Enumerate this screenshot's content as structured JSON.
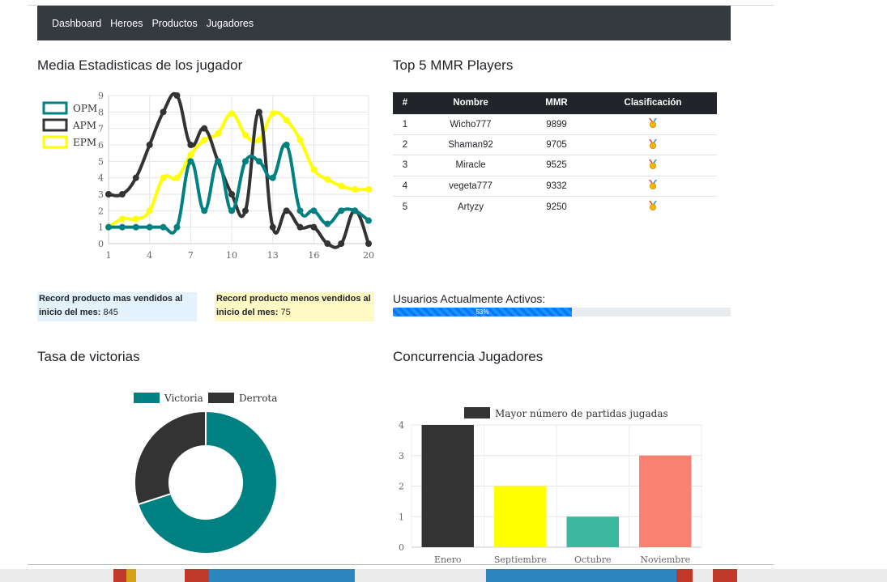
{
  "nav": {
    "items": [
      "Dashboard",
      "Heroes",
      "Productos",
      "Jugadores"
    ]
  },
  "sections": {
    "stats_title": "Media Estadisticas de los jugador",
    "mmr_title": "Top 5 MMR Players",
    "winrate_title": "Tasa de victorias",
    "concurrency_title": "Concurrencia Jugadores"
  },
  "mmr_table": {
    "headers": [
      "#",
      "Nombre",
      "MMR",
      "Clasificación"
    ],
    "rows": [
      {
        "rank": "1",
        "name": "Wicho777",
        "mmr": "9899",
        "icon": "medal-icon"
      },
      {
        "rank": "2",
        "name": "Shaman92",
        "mmr": "9705",
        "icon": "medal-icon"
      },
      {
        "rank": "3",
        "name": "Miracle",
        "mmr": "9525",
        "icon": "medal-icon"
      },
      {
        "rank": "4",
        "name": "vegeta777",
        "mmr": "9332",
        "icon": "medal-icon"
      },
      {
        "rank": "5",
        "name": "Artyzy",
        "mmr": "9250",
        "icon": "medal-icon"
      }
    ]
  },
  "records": {
    "most_label": "Record producto mas vendidos al inicio del mes:",
    "most_value": "845",
    "least_label": "Record producto menos vendidos al inicio del mes:",
    "least_value": "75"
  },
  "active_users": {
    "label": "Usuarios Actualmente Activos:",
    "percent_text": "53%",
    "percent": 53
  },
  "colors": {
    "teal": "#008080",
    "dark": "#333333",
    "yellow": "#ffff00",
    "green": "#3cb89e",
    "salmon": "#fa8072",
    "progress": "#007bff"
  },
  "chart_data": [
    {
      "type": "line",
      "x": [
        1,
        2,
        3,
        4,
        5,
        6,
        7,
        8,
        9,
        10,
        11,
        12,
        13,
        14,
        15,
        16,
        17,
        18,
        19,
        20
      ],
      "x_ticks": [
        1,
        4,
        7,
        10,
        13,
        16,
        20
      ],
      "ylim": [
        0,
        9
      ],
      "y_ticks": [
        0,
        1,
        2,
        3,
        4,
        5,
        6,
        7,
        8,
        9
      ],
      "legend": "top-left",
      "series": [
        {
          "name": "OPM",
          "color": "#008080",
          "values": [
            1,
            1,
            1,
            1,
            1,
            1,
            5,
            2,
            5,
            2,
            5,
            5,
            4,
            6,
            2,
            2,
            1.2,
            2,
            2,
            1.4
          ]
        },
        {
          "name": "APM",
          "color": "#333333",
          "values": [
            3,
            3,
            4,
            6,
            8,
            9,
            6,
            7,
            5,
            3,
            2,
            8,
            1,
            2,
            1,
            1,
            0,
            0,
            2,
            0
          ]
        },
        {
          "name": "EPM",
          "color": "#ffff00",
          "values": [
            1,
            1.5,
            1.5,
            2,
            4,
            4,
            5.4,
            6.3,
            6.7,
            7.9,
            6.6,
            6.3,
            7.9,
            7.5,
            6.3,
            4.5,
            3.9,
            3.5,
            3.3,
            3.3
          ]
        }
      ]
    },
    {
      "type": "pie",
      "style": "doughnut",
      "legend": "top",
      "labels": [
        "Victoria",
        "Derrota"
      ],
      "colors": [
        "#008080",
        "#333333"
      ],
      "values": [
        70,
        30
      ]
    },
    {
      "type": "bar",
      "legend": "top",
      "series_name": "Mayor número de partidas jugadas",
      "categories": [
        "Enero",
        "Septiembre",
        "Octubre",
        "Noviembre"
      ],
      "values": [
        4,
        2,
        1,
        3
      ],
      "colors": [
        "#333333",
        "#ffff00",
        "#3cb89e",
        "#fa8072"
      ],
      "ylim": [
        0,
        4
      ],
      "y_ticks": [
        0,
        1,
        2,
        3,
        4
      ]
    }
  ]
}
